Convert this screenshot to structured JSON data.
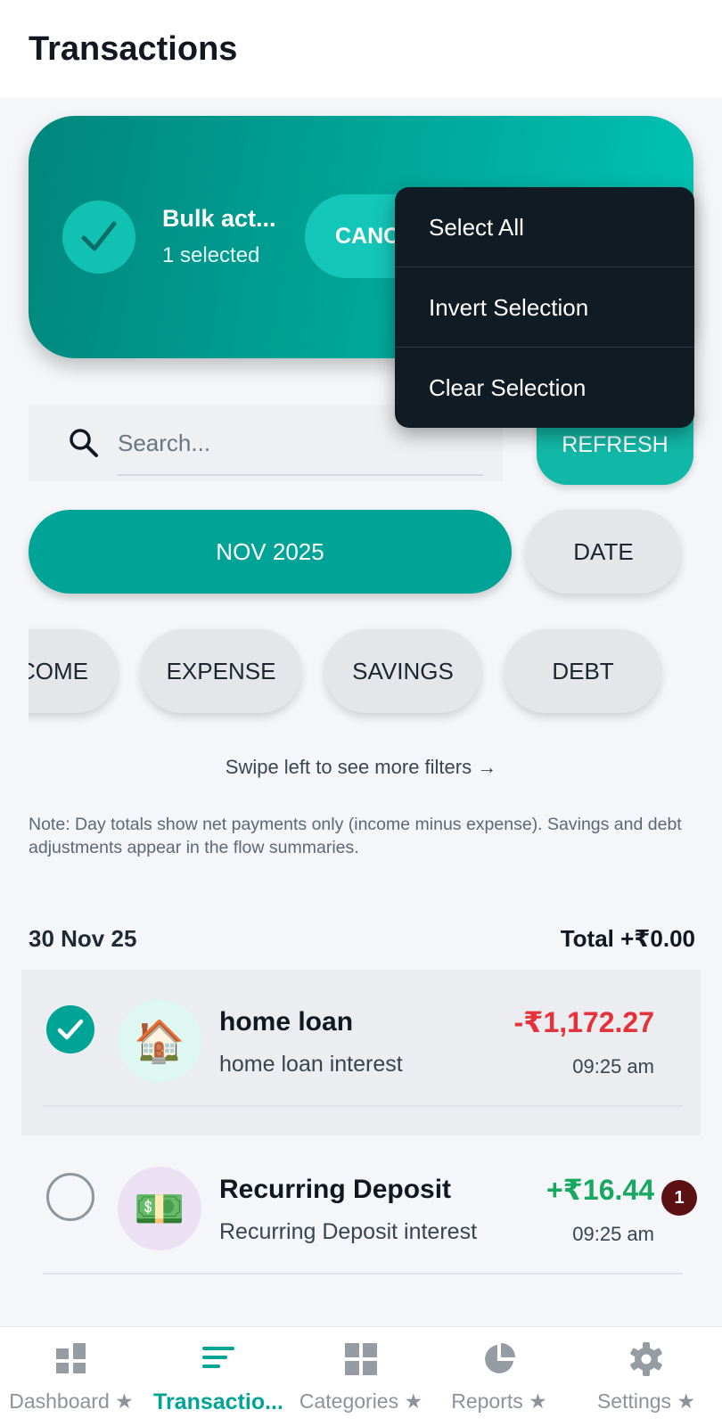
{
  "appbar": {
    "title": "Transactions"
  },
  "bulk": {
    "title": "Bulk act...",
    "selected": "1 selected",
    "cancel_label": "CANCEL"
  },
  "menu": {
    "items": [
      {
        "label": "Select All"
      },
      {
        "label": "Invert Selection"
      },
      {
        "label": "Clear Selection"
      }
    ]
  },
  "search": {
    "placeholder": "Search...",
    "refresh_label": "REFRESH"
  },
  "period": {
    "month_label": "NOV 2025",
    "sort_label": "DATE"
  },
  "filters": {
    "chips": [
      "INCOME",
      "EXPENSE",
      "SAVINGS",
      "DEBT"
    ]
  },
  "hint": {
    "swipe": "Swipe left to see more filters →"
  },
  "note": "Note: Day totals show net payments only (income minus expense). Savings and debt adjustments appear in the flow summaries.",
  "day": {
    "date": "30 Nov 25",
    "total": "Total +₹0.00"
  },
  "transactions": [
    {
      "title": "home loan",
      "subtitle": "home loan interest",
      "amount": "-₹1,172.27",
      "time": "09:25 am",
      "icon": "house-icon",
      "selected": true
    },
    {
      "title": "Recurring Deposit",
      "subtitle": "Recurring Deposit interest",
      "amount": "+₹16.44",
      "time": "09:25 am",
      "icon": "money-icon",
      "selected": false,
      "badge": "1"
    }
  ],
  "nav": {
    "items": [
      {
        "label": "Dashboard ★",
        "icon": "dashboard-icon"
      },
      {
        "label": "Transactio...",
        "icon": "transactions-icon"
      },
      {
        "label": "Categories ★",
        "icon": "categories-icon"
      },
      {
        "label": "Reports ★",
        "icon": "reports-icon"
      },
      {
        "label": "Settings ★",
        "icon": "settings-icon"
      }
    ]
  },
  "colors": {
    "accent": "#00a497",
    "negative": "#e5323a",
    "positive": "#18a85f",
    "menu_bg": "#111b24"
  }
}
